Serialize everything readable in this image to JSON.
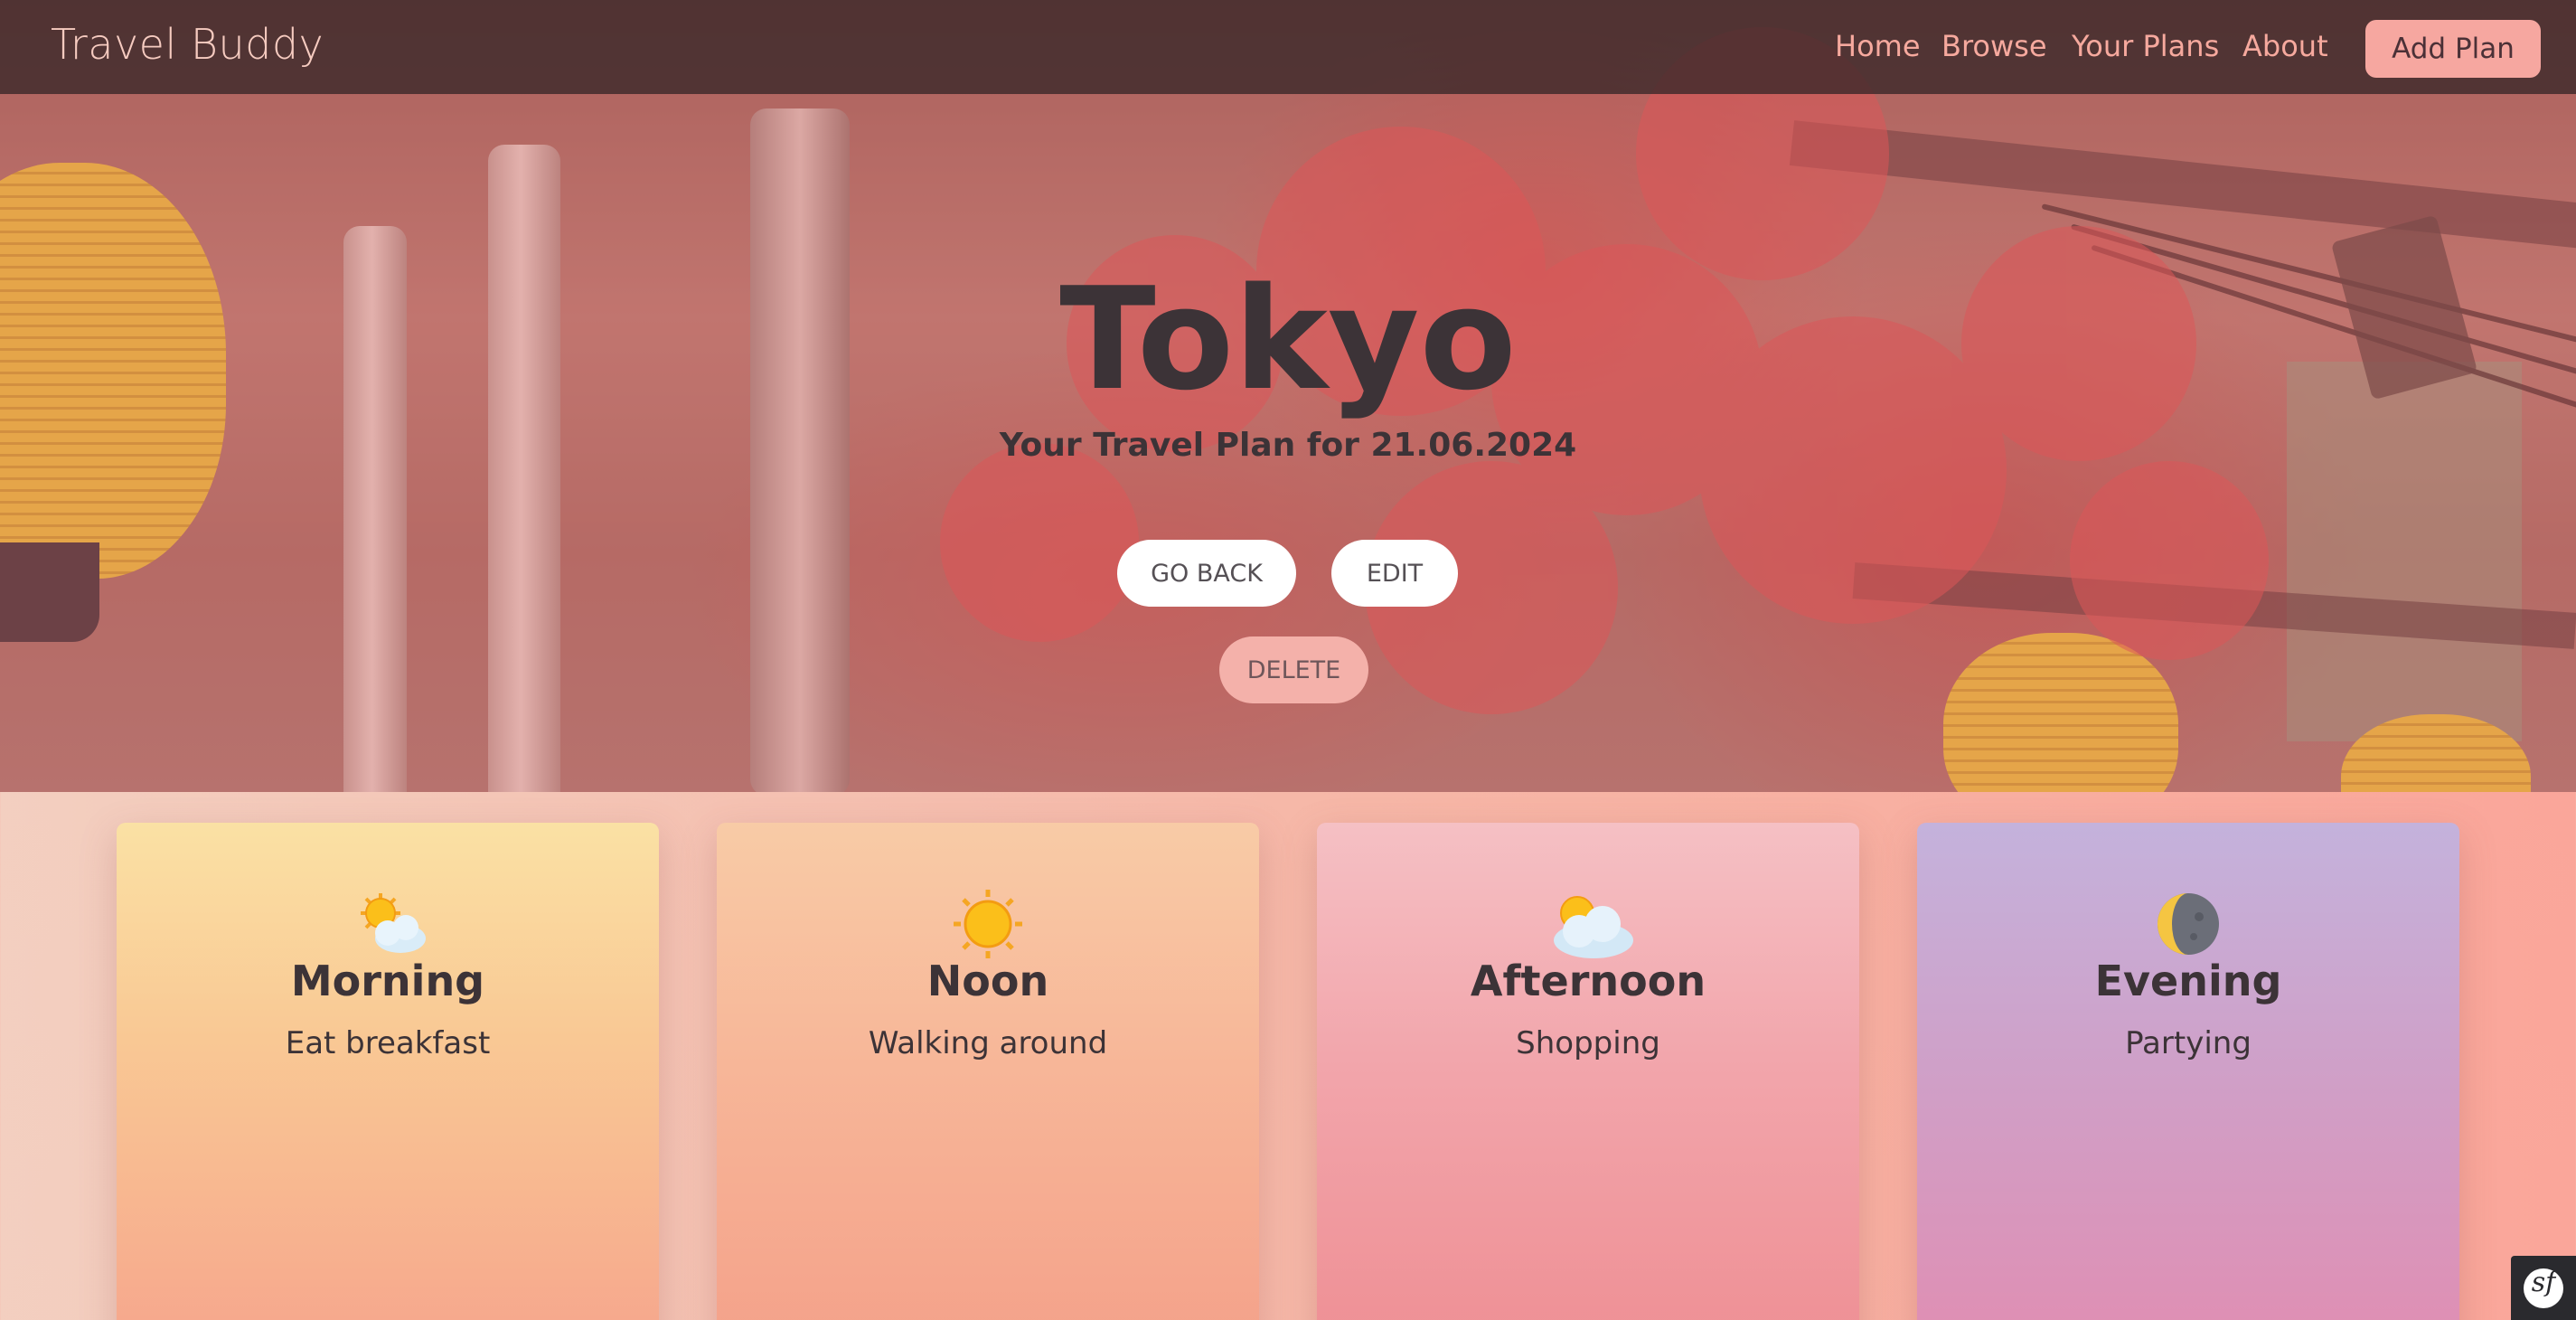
{
  "navbar": {
    "brand": "Travel Buddy",
    "links": [
      "Home",
      "Browse",
      "Your Plans",
      "About"
    ],
    "add_plan_label": "Add Plan"
  },
  "hero": {
    "title": "Tokyo",
    "subtitle": "Your Travel Plan for 21.06.2024",
    "buttons": {
      "go_back": "GO BACK",
      "edit": "EDIT",
      "delete": "DELETE"
    }
  },
  "cards": [
    {
      "icon": "sun-behind-cloud-icon",
      "title": "Morning",
      "activity": "Eat breakfast"
    },
    {
      "icon": "sun-icon",
      "title": "Noon",
      "activity": "Walking around"
    },
    {
      "icon": "sun-behind-large-cloud-icon",
      "title": "Afternoon",
      "activity": "Shopping"
    },
    {
      "icon": "half-moon-icon",
      "title": "Evening",
      "activity": "Partying"
    }
  ],
  "badge": {
    "icon": "symfony-icon"
  },
  "colors": {
    "navbar_bg": "#37262899",
    "brand": "#f6cbc0",
    "nav_link": "#f6a99e",
    "accent_button": "#f6a7a0",
    "text_dark": "#3c3337"
  }
}
